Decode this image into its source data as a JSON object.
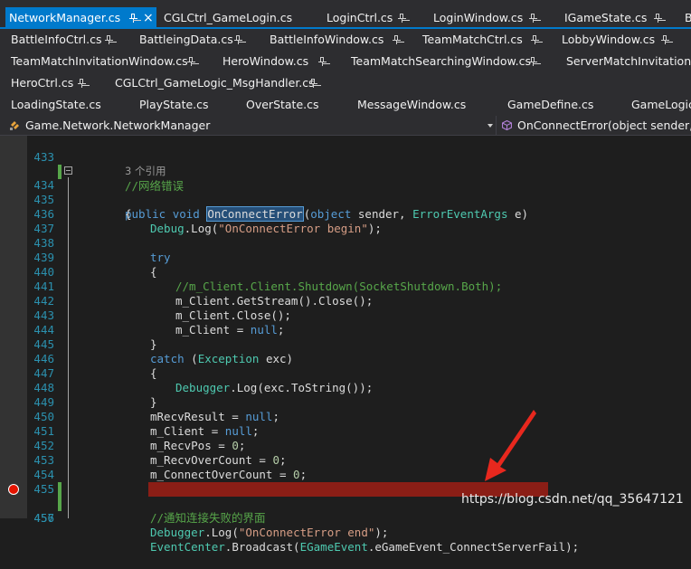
{
  "tabs": {
    "row1": [
      {
        "label": "NetworkManager.cs",
        "active": true,
        "pinned": true,
        "close": "×"
      },
      {
        "label": "CGLCtrl_GameLogin.cs",
        "pinned": false
      },
      {
        "label": "LoginCtrl.cs",
        "pinned": true
      },
      {
        "label": "LoginWindow.cs",
        "pinned": true
      },
      {
        "label": "IGameState.cs",
        "pinned": true
      },
      {
        "label": "B",
        "pinned": false
      }
    ],
    "row2": [
      {
        "label": "BattleInfoCtrl.cs",
        "pinned": true
      },
      {
        "label": "BattleingData.cs",
        "pinned": true
      },
      {
        "label": "BattleInfoWindow.cs",
        "pinned": true
      },
      {
        "label": "TeamMatchCtrl.cs",
        "pinned": true
      },
      {
        "label": "LobbyWindow.cs",
        "pinned": true
      }
    ],
    "row3": [
      {
        "label": "TeamMatchInvitationWindow.cs",
        "pinned": true
      },
      {
        "label": "HeroWindow.cs",
        "pinned": true
      },
      {
        "label": "TeamMatchSearchingWindow.cs",
        "pinned": true
      },
      {
        "label": "ServerMatchInvitationW",
        "pinned": false
      }
    ],
    "row4": [
      {
        "label": "HeroCtrl.cs",
        "pinned": true
      },
      {
        "label": "CGLCtrl_GameLogic_MsgHandler.cs",
        "pinned": true
      }
    ],
    "row5": [
      {
        "label": "LoadingState.cs",
        "pinned": false
      },
      {
        "label": "PlayState.cs",
        "pinned": false
      },
      {
        "label": "OverState.cs",
        "pinned": false
      },
      {
        "label": "MessageWindow.cs",
        "pinned": false
      },
      {
        "label": "GameDefine.cs",
        "pinned": false
      },
      {
        "label": "GameLogic",
        "pinned": false
      }
    ]
  },
  "navbar": {
    "type_scope": "Game.Network.NetworkManager",
    "member_scope": "OnConnectError(object sender, E"
  },
  "editor": {
    "codelens": "3 个引用",
    "lines": [
      {
        "n": "433"
      },
      {
        "n": "434"
      },
      {
        "n": "435"
      },
      {
        "n": "436"
      },
      {
        "n": "437"
      },
      {
        "n": "438"
      },
      {
        "n": "439"
      },
      {
        "n": "440"
      },
      {
        "n": "441"
      },
      {
        "n": "442"
      },
      {
        "n": "443"
      },
      {
        "n": "444"
      },
      {
        "n": "445"
      },
      {
        "n": "446"
      },
      {
        "n": "447"
      },
      {
        "n": "448"
      },
      {
        "n": "449"
      },
      {
        "n": "450"
      },
      {
        "n": "451"
      },
      {
        "n": "452"
      },
      {
        "n": "453"
      },
      {
        "n": "454"
      },
      {
        "n": "455"
      },
      {
        "n": "456"
      },
      {
        "n": "457"
      }
    ],
    "code": {
      "c433": "//网络错误",
      "c434_public": "public",
      "c434_void": "void",
      "c434_name": "OnConnectError",
      "c434_open": "(",
      "c434_object": "object",
      "c434_sender": " sender, ",
      "c434_type": "ErrorEventArgs",
      "c434_rest": " e)",
      "c435": "{",
      "c436_a": "Debug",
      "c436_b": ".Log(",
      "c436_s": "\"OnConnectError begin\"",
      "c436_c": ");",
      "c438": "try",
      "c439": "{",
      "c440": "//m_Client.Client.Shutdown(SocketShutdown.Both);",
      "c441": "m_Client.GetStream().Close();",
      "c442": "m_Client.Close();",
      "c443_a": "m_Client = ",
      "c443_null": "null",
      "c443_b": ";",
      "c444": "}",
      "c445_catch": "catch",
      "c445_a": " (",
      "c445_type": "Exception",
      "c445_b": " exc)",
      "c446": "{",
      "c447_type": "Debugger",
      "c447_a": ".Log(exc.ToString());",
      "c448": "}",
      "c449_a": "mRecvResult = ",
      "c449_null": "null",
      "c449_b": ";",
      "c450_a": "m_Client = ",
      "c450_null": "null",
      "c450_b": ";",
      "c451_a": "m_RecvPos = ",
      "c451_n": "0",
      "c451_b": ";",
      "c452_a": "m_RecvOverCount = ",
      "c452_n": "0",
      "c452_b": ";",
      "c453_a": "m_ConnectOverCount = ",
      "c453_n": "0",
      "c453_b": ";",
      "c455": "//通知连接失败的界面",
      "c456_type": "EventCenter",
      "c456_a": ".Broadcast(",
      "c456_enum": "EGameEvent",
      "c456_b": ".eGameEvent_ConnectServerFail);",
      "c457_type": "Debugger",
      "c457_a": ".Log(",
      "c457_s": "\"OnConnectError end\"",
      "c457_b": ");"
    }
  },
  "watermark": "https://blog.csdn.net/qq_35647121",
  "colors": {
    "active_tab": "#007acc",
    "breakpoint": "#e51400",
    "annotation_arrow": "#e8281e"
  }
}
